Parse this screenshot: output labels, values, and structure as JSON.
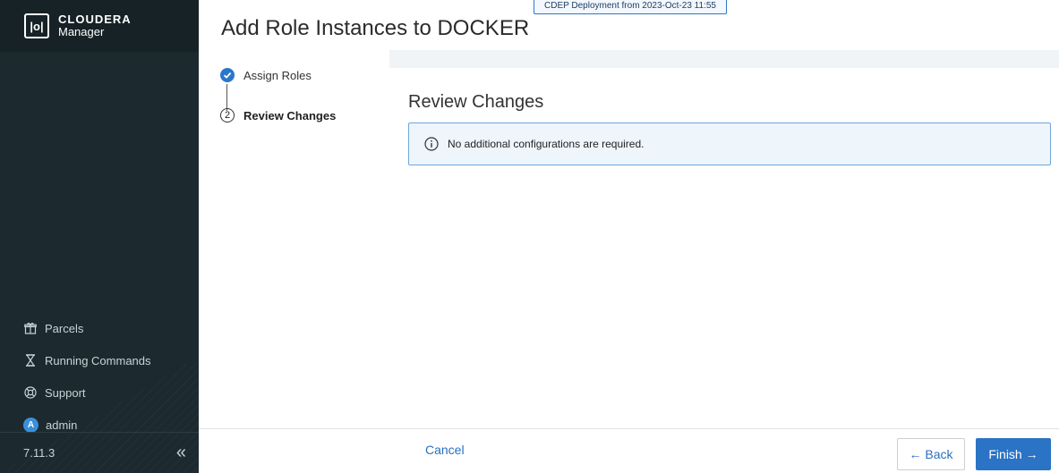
{
  "sidebar": {
    "logo_text": "|o|",
    "brand_name": "CLOUDERA",
    "brand_sub": "Manager",
    "items": [
      {
        "label": "Parcels",
        "icon": "gift-icon"
      },
      {
        "label": "Running Commands",
        "icon": "hourglass-icon"
      },
      {
        "label": "Support",
        "icon": "lifebuoy-icon"
      }
    ],
    "user": {
      "initial": "A",
      "name": "admin"
    },
    "version": "7.11.3",
    "collapse_glyph": "«"
  },
  "header": {
    "title": "Add Role Instances to DOCKER",
    "deployment_badge": "CDEP Deployment from 2023-Oct-23 11:55"
  },
  "steps": [
    {
      "number": "",
      "label": "Assign Roles",
      "state": "done"
    },
    {
      "number": "2",
      "label": "Review Changes",
      "state": "current"
    }
  ],
  "main": {
    "section_title": "Review Changes",
    "info_message": "No additional configurations are required."
  },
  "footer": {
    "cancel_label": "Cancel",
    "back_label": "← Back",
    "finish_label": "Finish →"
  },
  "colors": {
    "sidebar_bg": "#1c2a30",
    "accent": "#2a73c5",
    "info_border": "#6fa6dc"
  }
}
